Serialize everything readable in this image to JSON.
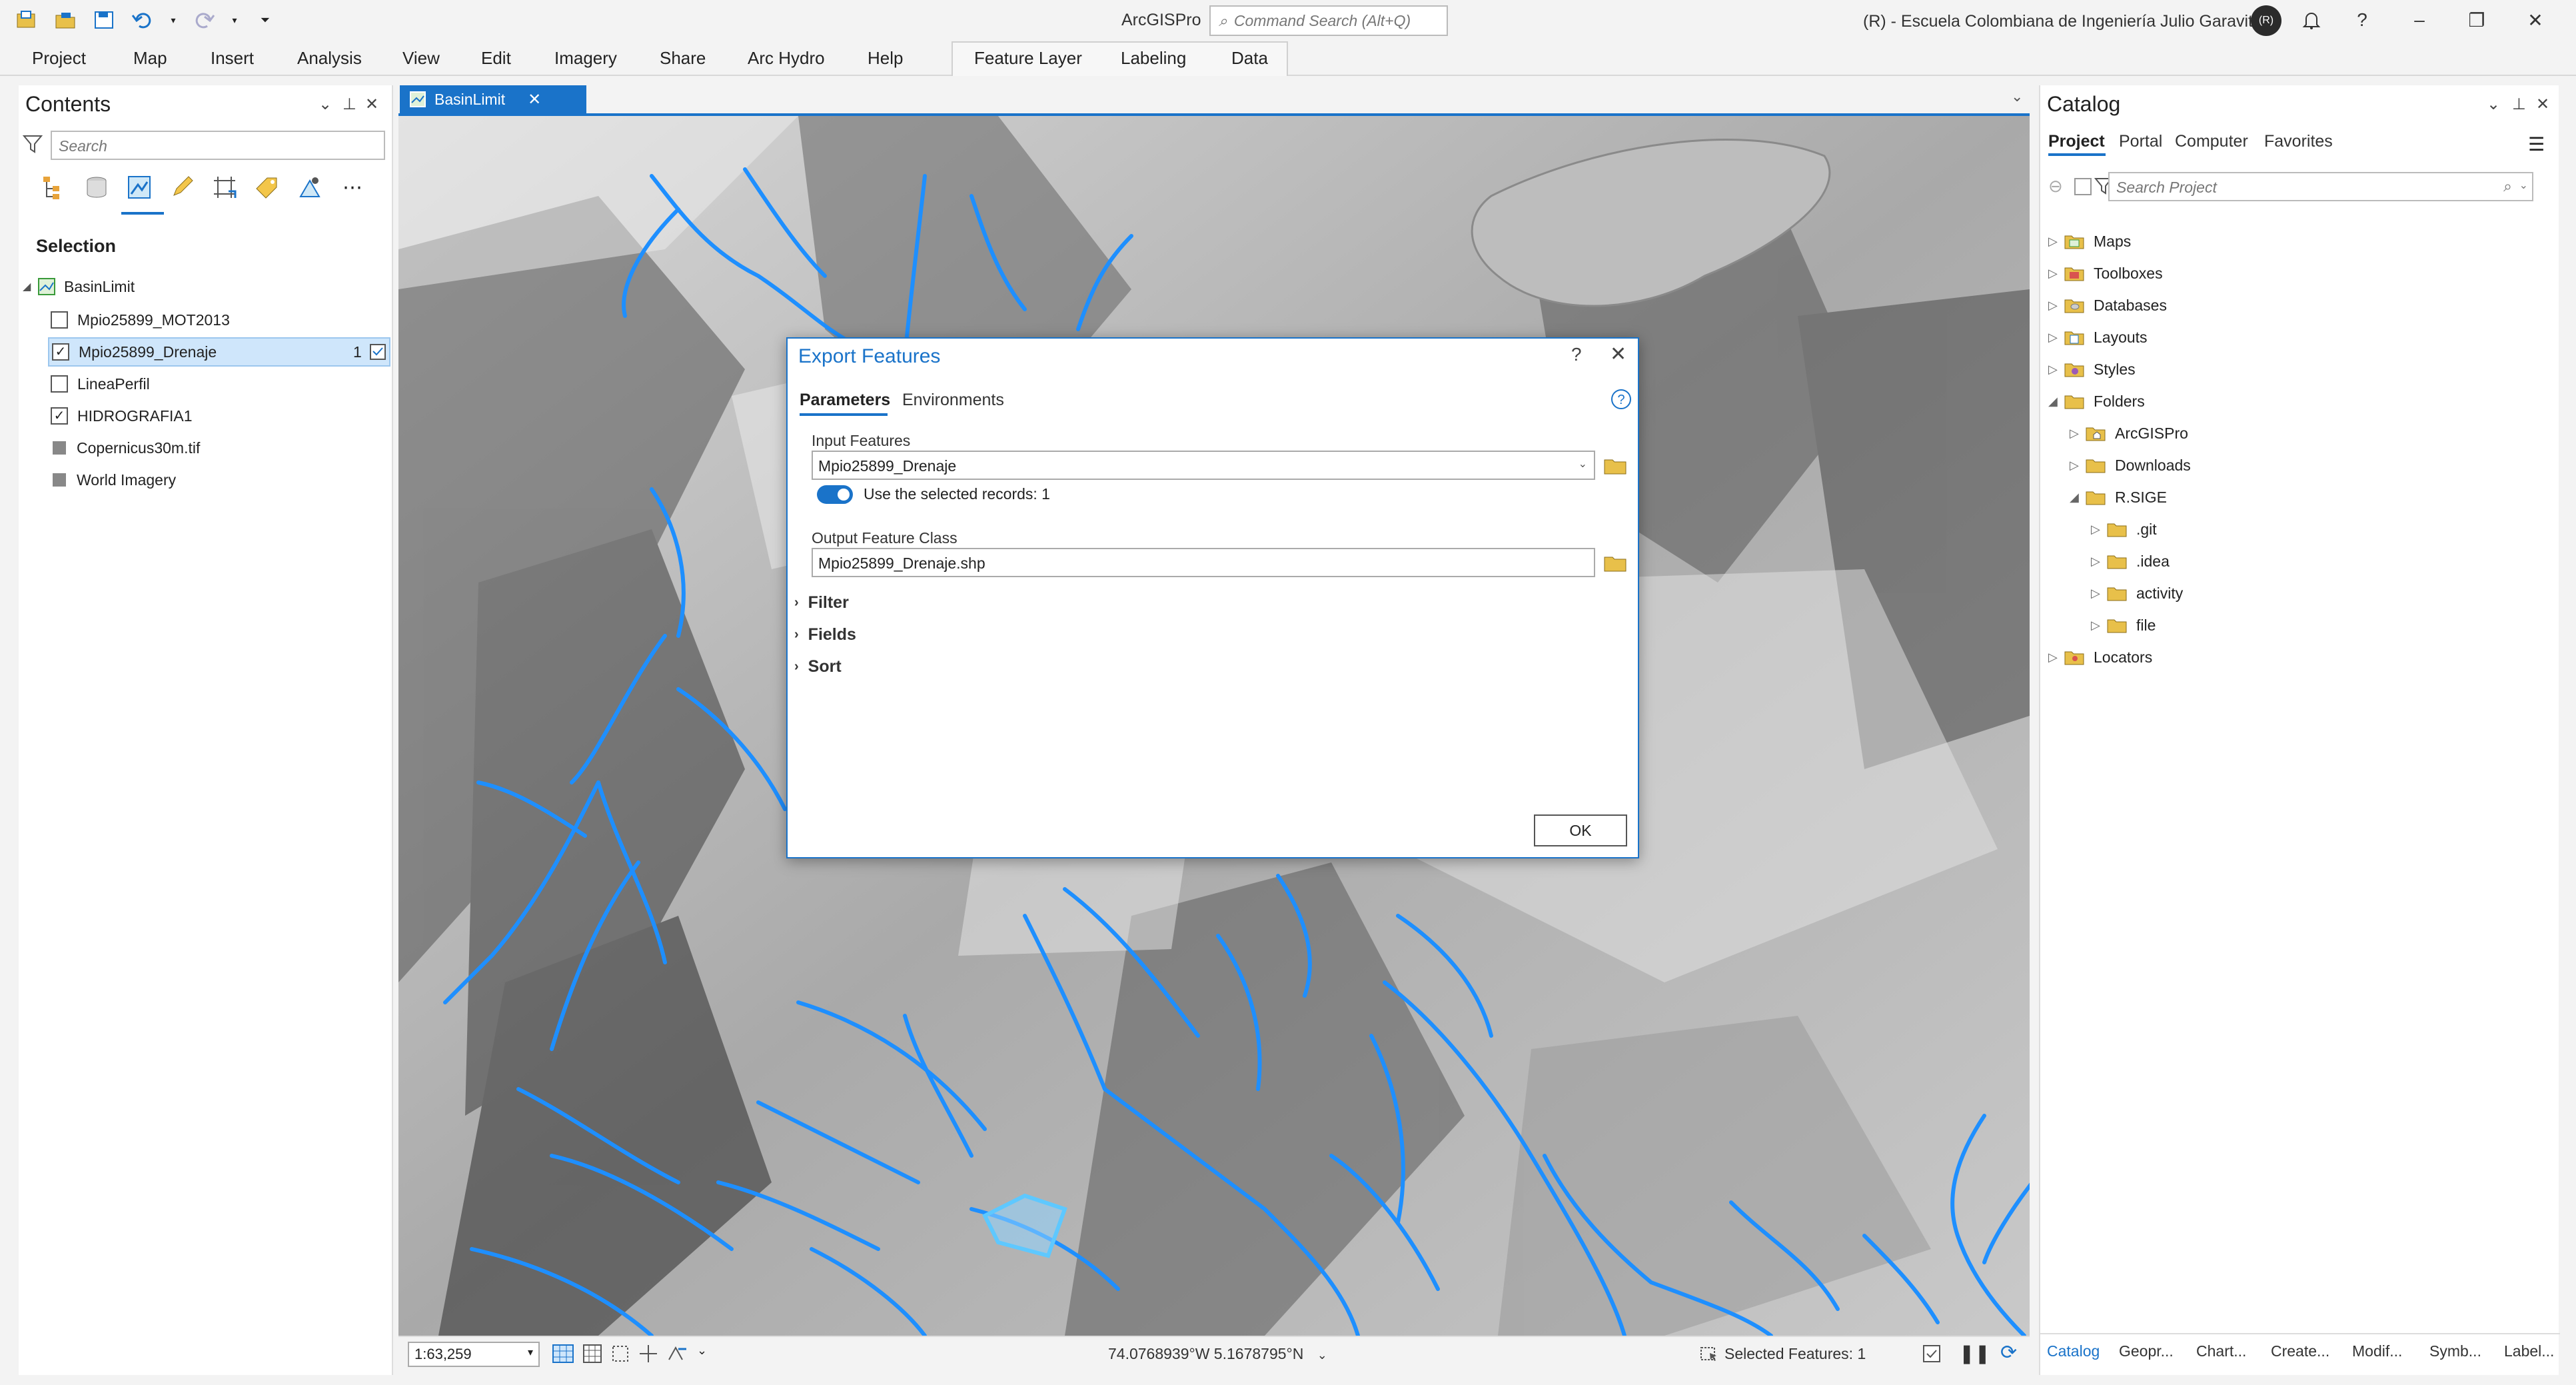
{
  "app": {
    "title": "ArcGISPro",
    "command_search_placeholder": "Command Search (Alt+Q)",
    "org": "(R) - Escuela Colombiana de Ingeniería Julio Garavito",
    "avatar_initials": "(R)"
  },
  "ribbon": {
    "tabs": [
      "Project",
      "Map",
      "Insert",
      "Analysis",
      "View",
      "Edit",
      "Imagery",
      "Share",
      "Arc Hydro",
      "Help"
    ],
    "context_tabs": [
      "Feature Layer",
      "Labeling",
      "Data"
    ]
  },
  "contents": {
    "title": "Contents",
    "search_placeholder": "Search",
    "section": "Selection",
    "map_name": "BasinLimit",
    "layers": [
      {
        "name": "Mpio25899_MOT2013",
        "type": "checkbox",
        "checked": false
      },
      {
        "name": "Mpio25899_Drenaje",
        "type": "checkbox",
        "checked": true,
        "count": "1",
        "selected": true
      },
      {
        "name": "LineaPerfil",
        "type": "checkbox",
        "checked": false
      },
      {
        "name": "HIDROGRAFIA1",
        "type": "checkbox",
        "checked": true
      },
      {
        "name": "Copernicus30m.tif",
        "type": "raster"
      },
      {
        "name": "World Imagery",
        "type": "raster"
      }
    ]
  },
  "map": {
    "tab_label": "BasinLimit",
    "scale": "1:63,259",
    "coordinates": "74.0768939°W 5.1678795°N",
    "selected_features": "Selected Features: 1",
    "colors": {
      "drainage": "#1e8fff",
      "selected": "#5ec8ff"
    }
  },
  "dialog": {
    "title": "Export Features",
    "tabs": [
      "Parameters",
      "Environments"
    ],
    "input_label": "Input Features",
    "input_value": "Mpio25899_Drenaje",
    "toggle_label": "Use the selected records: 1",
    "output_label": "Output Feature Class",
    "output_value": "Mpio25899_Drenaje.shp",
    "sections": [
      "Filter",
      "Fields",
      "Sort"
    ],
    "ok_label": "OK"
  },
  "catalog": {
    "title": "Catalog",
    "tabs": [
      "Project",
      "Portal",
      "Computer",
      "Favorites"
    ],
    "search_placeholder": "Search Project",
    "items": [
      {
        "label": "Maps",
        "level": 0,
        "open": false
      },
      {
        "label": "Toolboxes",
        "level": 0,
        "open": false
      },
      {
        "label": "Databases",
        "level": 0,
        "open": false
      },
      {
        "label": "Layouts",
        "level": 0,
        "open": false
      },
      {
        "label": "Styles",
        "level": 0,
        "open": false
      },
      {
        "label": "Folders",
        "level": 0,
        "open": true
      },
      {
        "label": "ArcGISPro",
        "level": 1,
        "open": false
      },
      {
        "label": "Downloads",
        "level": 1,
        "open": false
      },
      {
        "label": "R.SIGE",
        "level": 1,
        "open": true
      },
      {
        "label": ".git",
        "level": 2,
        "open": false
      },
      {
        "label": ".idea",
        "level": 2,
        "open": false
      },
      {
        "label": "activity",
        "level": 2,
        "open": false
      },
      {
        "label": "file",
        "level": 2,
        "open": false
      },
      {
        "label": "Locators",
        "level": 0,
        "open": false
      }
    ],
    "bottom_tabs": [
      "Catalog",
      "Geopr...",
      "Chart...",
      "Create...",
      "Modif...",
      "Symb...",
      "Label..."
    ]
  }
}
